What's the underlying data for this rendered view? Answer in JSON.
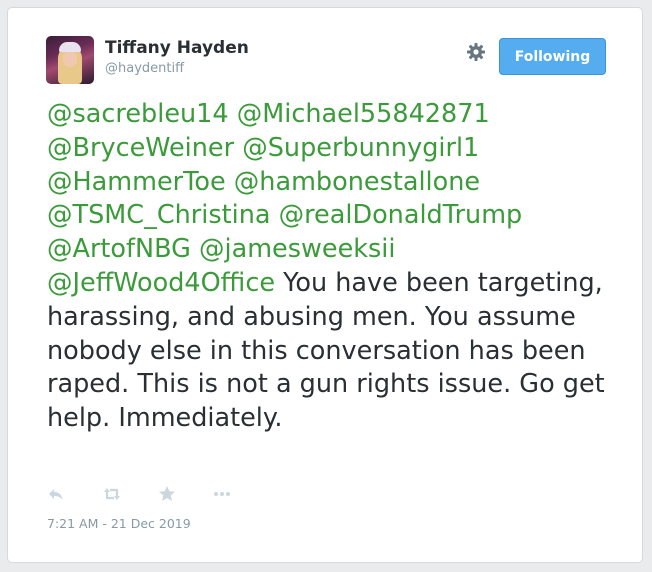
{
  "author": {
    "name": "Tiffany Hayden",
    "handle": "@haydentiff"
  },
  "follow_button": {
    "label": "Following",
    "color": "#55acee"
  },
  "tweet": {
    "mentions": [
      "@sacrebleu14",
      "@Michael55842871",
      "@BryceWeiner",
      "@Superbunnygirl1",
      "@HammerToe",
      "@hambonestallone",
      "@TSMC_Christina",
      "@realDonaldTrump",
      "@ArtofNBG",
      "@jamesweeksii",
      "@JeffWood4Office"
    ],
    "body": "You have been targeting, harassing, and abusing men. You assume nobody else in this conversation has been raped. This is not a gun rights issue. Go get help. Immediately.",
    "mention_color": "#3b9b3b"
  },
  "actions": [
    "reply-icon",
    "retweet-icon",
    "favorite-icon",
    "more-icon"
  ],
  "timestamp": "7:21 AM - 21 Dec 2019"
}
